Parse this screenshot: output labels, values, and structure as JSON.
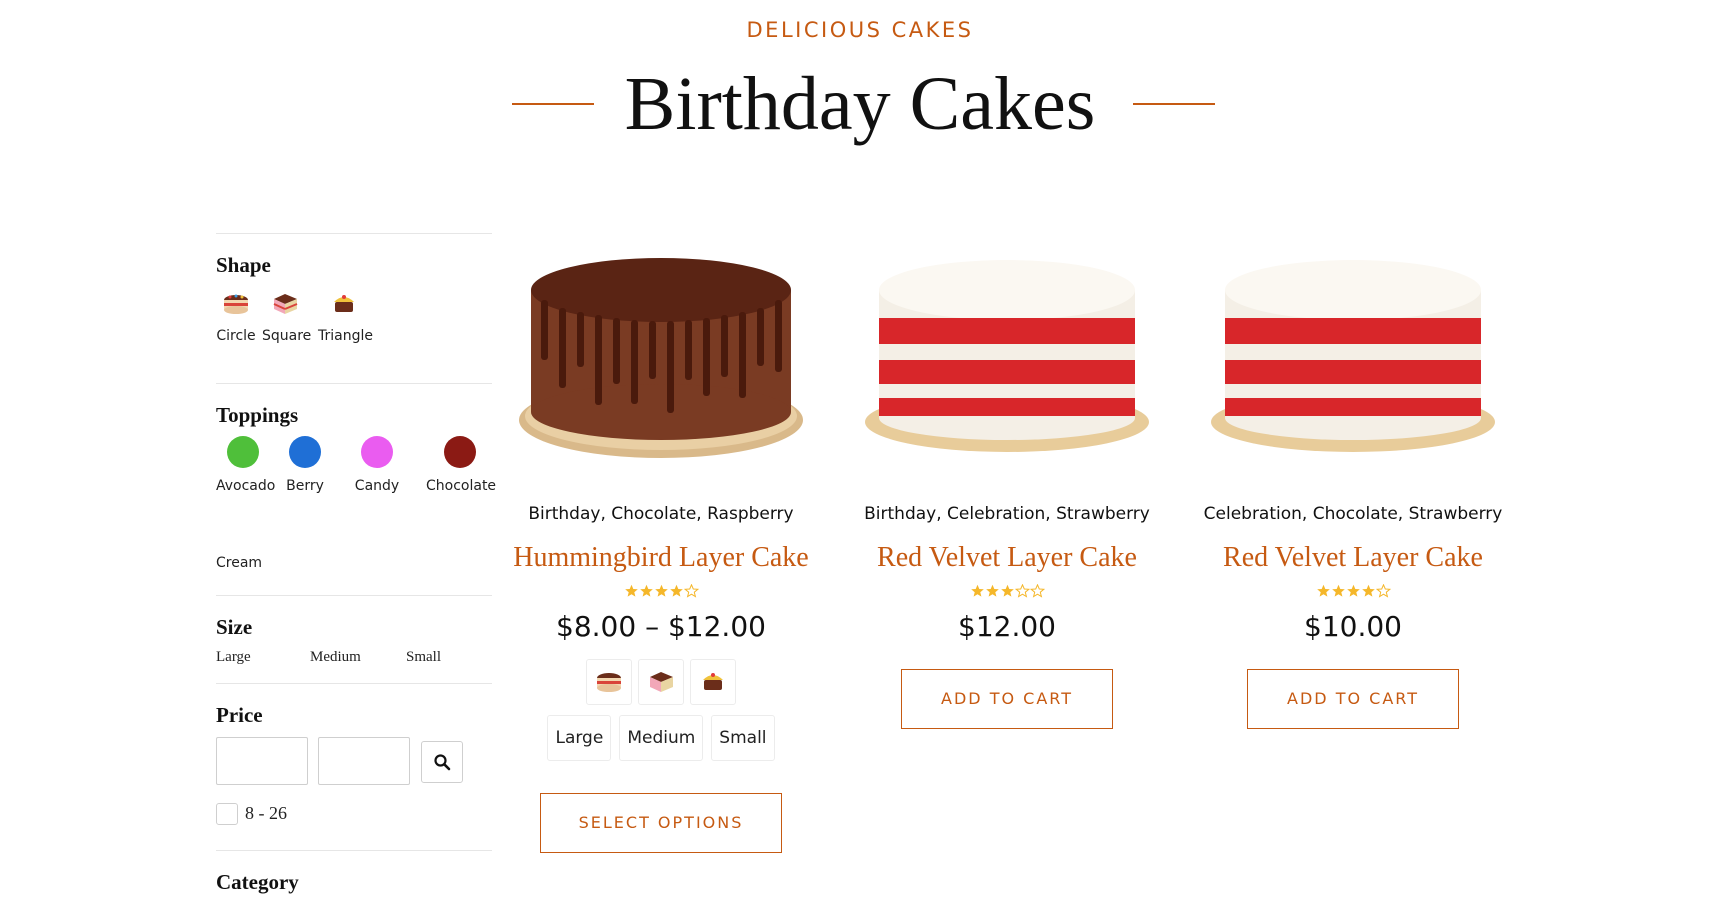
{
  "header": {
    "eyebrow": "DELICIOUS CAKES",
    "title": "Birthday Cakes",
    "accent_color": "#c65a12"
  },
  "filters": {
    "shape": {
      "heading": "Shape",
      "options": [
        {
          "label": "Circle",
          "icon": "round-cake-icon"
        },
        {
          "label": "Square",
          "icon": "square-cake-icon"
        },
        {
          "label": "Triangle",
          "icon": "triangle-cake-icon"
        }
      ]
    },
    "toppings": {
      "heading": "Toppings",
      "options": [
        {
          "label": "Avocado",
          "color": "#4fbf3a"
        },
        {
          "label": "Berry",
          "color": "#1f6fd6"
        },
        {
          "label": "Candy",
          "color": "#ea5cf0"
        },
        {
          "label": "Chocolate",
          "color": "#8b1a14"
        },
        {
          "label": "Cream",
          "color": "#ffffff"
        }
      ]
    },
    "size": {
      "heading": "Size",
      "options": [
        "Large",
        "Medium",
        "Small"
      ]
    },
    "price": {
      "heading": "Price",
      "min_value": "",
      "max_value": "",
      "range_label": "8 - 26"
    },
    "category": {
      "heading": "Category"
    }
  },
  "products": [
    {
      "categories": "Birthday, Chocolate, Raspberry",
      "name": "Hummingbird Layer Cake",
      "rating": 4,
      "price": "$8.00 – $12.00",
      "variant_icons": [
        "round-cake-icon",
        "square-cake-icon",
        "triangle-cake-icon"
      ],
      "sizes": [
        "Large",
        "Medium",
        "Small"
      ],
      "button": "SELECT OPTIONS",
      "image": "chocolate-drip-cake-image"
    },
    {
      "categories": "Birthday, Celebration, Strawberry",
      "name": "Red Velvet Layer Cake",
      "rating": 3,
      "price": "$12.00",
      "button": "ADD TO CART",
      "image": "red-velvet-cake-image"
    },
    {
      "categories": "Celebration, Chocolate, Strawberry",
      "name": "Red Velvet Layer Cake",
      "rating": 4,
      "price": "$10.00",
      "button": "ADD TO CART",
      "image": "red-velvet-cake-image"
    }
  ]
}
